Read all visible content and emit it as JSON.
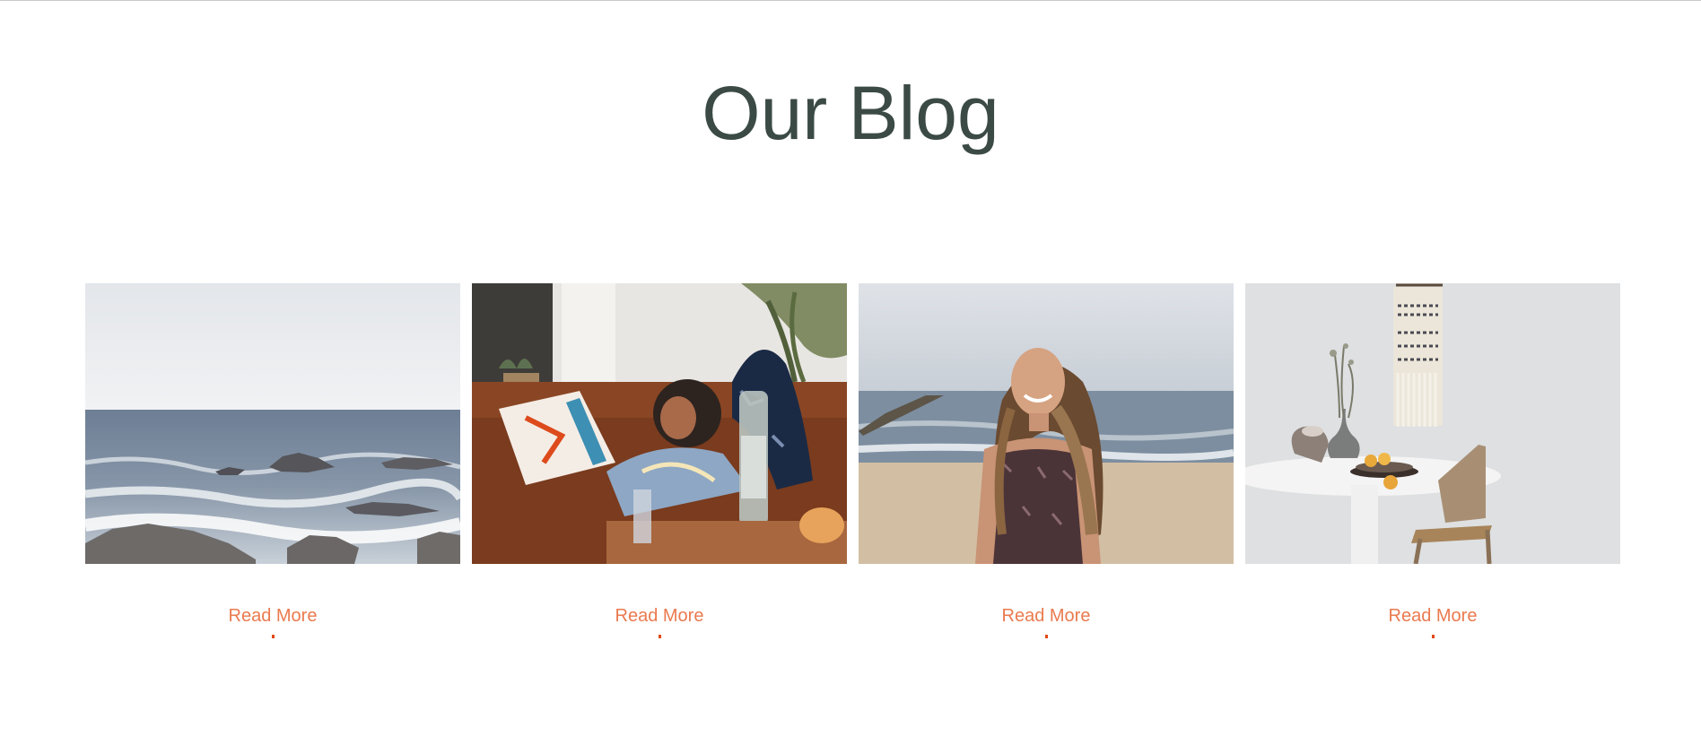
{
  "section": {
    "title": "Our Blog"
  },
  "posts": [
    {
      "image_icon": "ocean-rocks-photo",
      "link_label": "Read More"
    },
    {
      "image_icon": "woman-laughing-on-sofa-photo",
      "link_label": "Read More"
    },
    {
      "image_icon": "woman-smiling-on-beach-photo",
      "link_label": "Read More"
    },
    {
      "image_icon": "white-table-with-vase-photo",
      "link_label": "Read More"
    }
  ],
  "colors": {
    "title": "#3b4a45",
    "accent": "#ea7a4f",
    "accent_dot": "#e24a14"
  }
}
